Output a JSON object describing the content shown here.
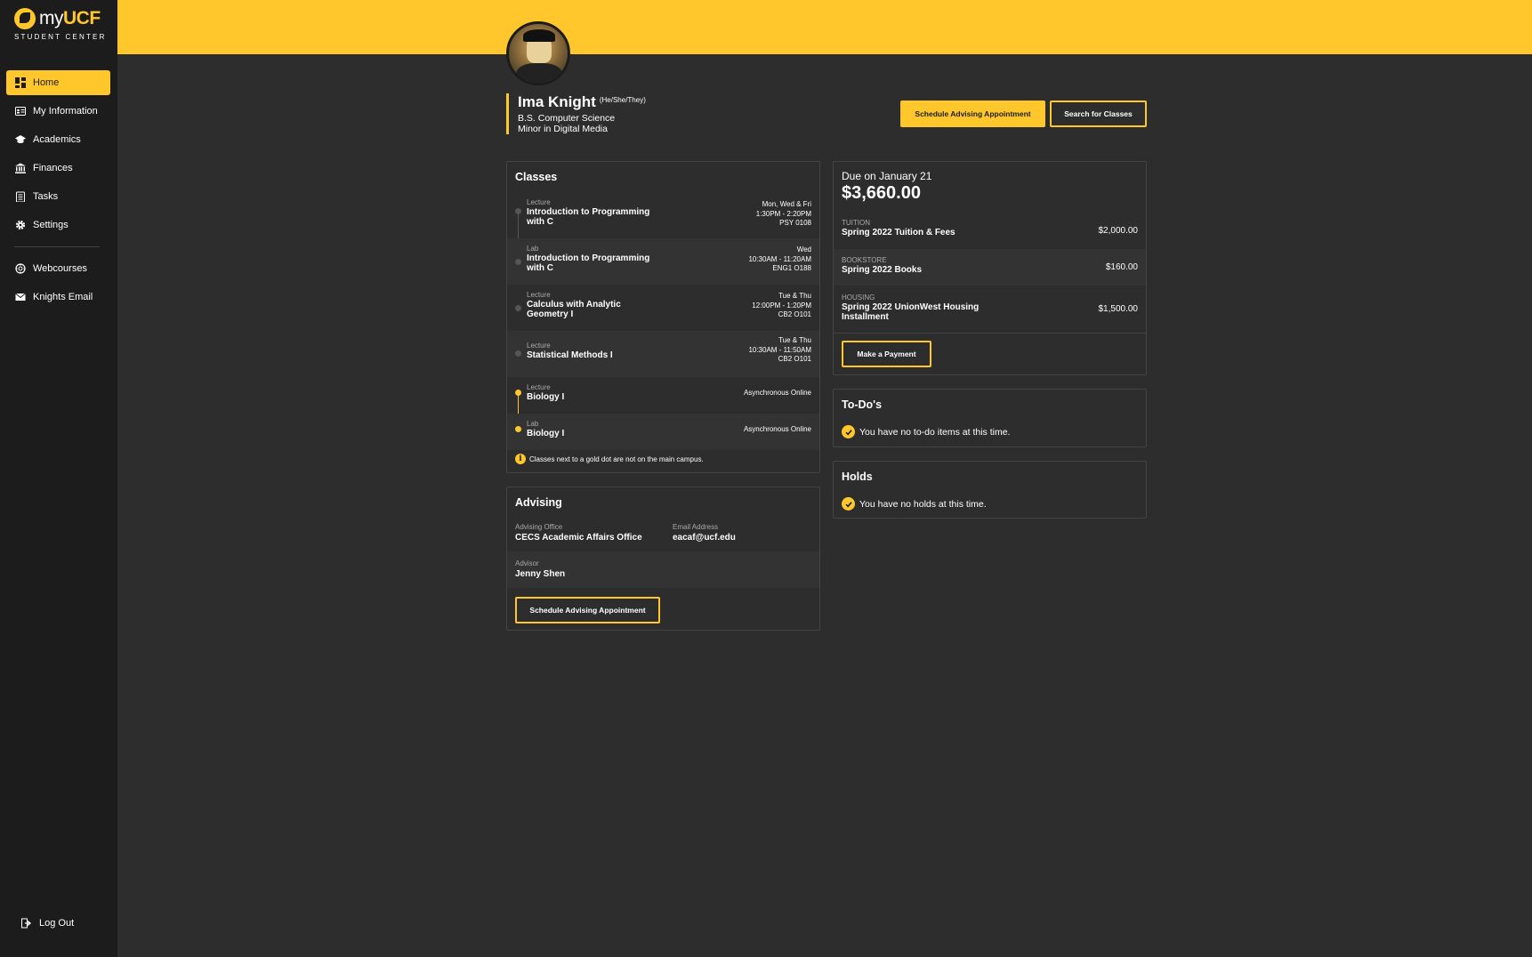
{
  "app": {
    "logo_my": "my",
    "logo_ucf": "UCF",
    "logo_sub": "STUDENT CENTER"
  },
  "sidebar": {
    "items": [
      {
        "label": "Home",
        "icon": "dashboard-icon"
      },
      {
        "label": "My Information",
        "icon": "id-card-icon"
      },
      {
        "label": "Academics",
        "icon": "graduation-cap-icon"
      },
      {
        "label": "Finances",
        "icon": "bank-icon"
      },
      {
        "label": "Tasks",
        "icon": "clipboard-icon"
      },
      {
        "label": "Settings",
        "icon": "gear-icon"
      }
    ],
    "links": [
      {
        "label": "Webcourses",
        "icon": "webcourses-icon"
      },
      {
        "label": "Knights Email",
        "icon": "mail-icon"
      }
    ],
    "logout": "Log Out"
  },
  "profile": {
    "name": "Ima Knight",
    "pronouns": "(He/She/They)",
    "major": "B.S. Computer Science",
    "minor": "Minor in Digital Media"
  },
  "actions": {
    "schedule_advising": "Schedule Advising Appointment",
    "search_classes": "Search for Classes"
  },
  "classes": {
    "title": "Classes",
    "items": [
      {
        "kind": "Lecture",
        "name": "Introduction to Programming with C",
        "days": "Mon, Wed & Fri",
        "time": "1:30PM - 2:20PM",
        "room": "PSY 0108",
        "gold": false
      },
      {
        "kind": "Lab",
        "name": "Introduction to Programming with C",
        "days": "Wed",
        "time": "10:30AM - 11:20AM",
        "room": "ENG1 O188",
        "gold": false
      },
      {
        "kind": "Lecture",
        "name": "Calculus with Analytic Geometry I",
        "days": "Tue & Thu",
        "time": "12:00PM - 1:20PM",
        "room": "CB2 O101",
        "gold": false
      },
      {
        "kind": "Lecture",
        "name": "Statistical Methods I",
        "days": "Tue & Thu",
        "time": "10:30AM - 11:50AM",
        "room": "CB2 O101",
        "gold": false
      },
      {
        "kind": "Lecture",
        "name": "Biology I",
        "days": "Asynchronous Online",
        "time": "",
        "room": "",
        "gold": true
      },
      {
        "kind": "Lab",
        "name": "Biology I",
        "days": "Asynchronous Online",
        "time": "",
        "room": "",
        "gold": true
      }
    ],
    "note": "Classes next to a gold dot are not on the main campus."
  },
  "advising": {
    "title": "Advising",
    "office_label": "Advising Office",
    "office": "CECS Academic Affairs Office",
    "email_label": "Email Address",
    "email": "eacaf@ucf.edu",
    "advisor_label": "Advisor",
    "advisor": "Jenny Shen",
    "button": "Schedule Advising Appointment"
  },
  "finances": {
    "due_label": "Due on January 21",
    "total": "$3,660.00",
    "items": [
      {
        "category": "TUITION",
        "name": "Spring 2022 Tuition & Fees",
        "amount": "$2,000.00"
      },
      {
        "category": "BOOKSTORE",
        "name": "Spring 2022 Books",
        "amount": "$160.00"
      },
      {
        "category": "HOUSING",
        "name": "Spring 2022 UnionWest Housing Installment",
        "amount": "$1,500.00"
      }
    ],
    "button": "Make a Payment"
  },
  "todos": {
    "title": "To-Do's",
    "message": "You have no to-do items at this time."
  },
  "holds": {
    "title": "Holds",
    "message": "You have no holds at this time."
  },
  "colors": {
    "accent": "#ffc72c",
    "sidebar": "#1c1c1c",
    "background": "#2d2d2d"
  }
}
